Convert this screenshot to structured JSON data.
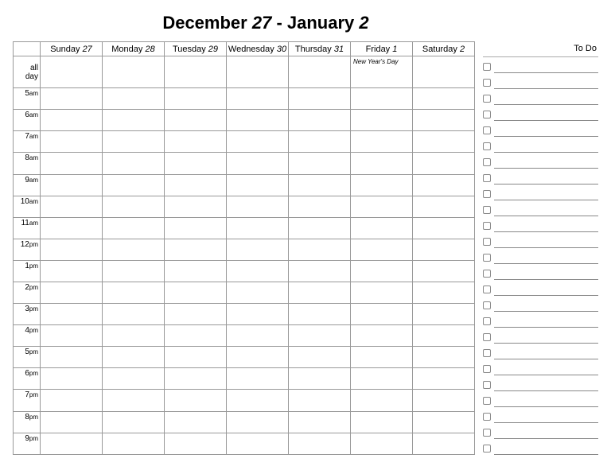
{
  "title": {
    "month_a": "December",
    "num_a": "27",
    "sep": " - ",
    "month_b": "January",
    "num_b": "2"
  },
  "days": [
    {
      "name": "Sunday",
      "num": "27",
      "allday": ""
    },
    {
      "name": "Monday",
      "num": "28",
      "allday": ""
    },
    {
      "name": "Tuesday",
      "num": "29",
      "allday": ""
    },
    {
      "name": "Wednesday",
      "num": "30",
      "allday": ""
    },
    {
      "name": "Thursday",
      "num": "31",
      "allday": ""
    },
    {
      "name": "Friday",
      "num": "1",
      "allday": "New Year's Day"
    },
    {
      "name": "Saturday",
      "num": "2",
      "allday": ""
    }
  ],
  "allday_label_line1": "all",
  "allday_label_line2": "day",
  "hours": [
    {
      "h": "5",
      "ap": "am"
    },
    {
      "h": "6",
      "ap": "am"
    },
    {
      "h": "7",
      "ap": "am"
    },
    {
      "h": "8",
      "ap": "am"
    },
    {
      "h": "9",
      "ap": "am"
    },
    {
      "h": "10",
      "ap": "am"
    },
    {
      "h": "11",
      "ap": "am"
    },
    {
      "h": "12",
      "ap": "pm"
    },
    {
      "h": "1",
      "ap": "pm"
    },
    {
      "h": "2",
      "ap": "pm"
    },
    {
      "h": "3",
      "ap": "pm"
    },
    {
      "h": "4",
      "ap": "pm"
    },
    {
      "h": "5",
      "ap": "pm"
    },
    {
      "h": "6",
      "ap": "pm"
    },
    {
      "h": "7",
      "ap": "pm"
    },
    {
      "h": "8",
      "ap": "pm"
    },
    {
      "h": "9",
      "ap": "pm"
    }
  ],
  "todo": {
    "header": "To Do",
    "count": 25
  }
}
